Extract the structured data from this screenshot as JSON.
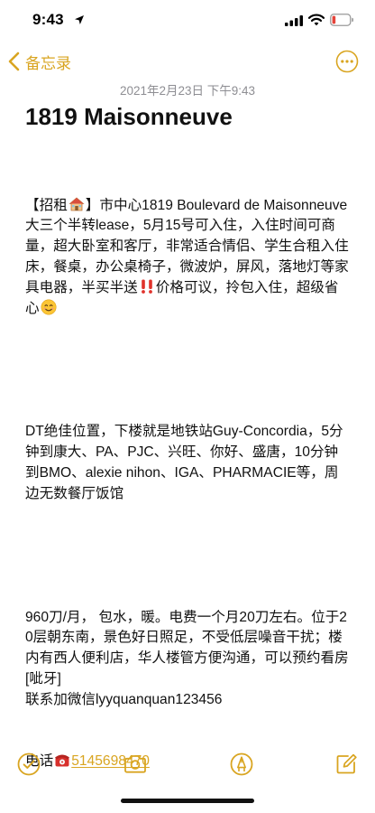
{
  "status_bar": {
    "time": "9:43"
  },
  "nav": {
    "back_label": "备忘录"
  },
  "note": {
    "date": "2021年2月23日 下午9:43",
    "title": "1819 Maisonneuve",
    "p1_a": "【招租",
    "p1_b": "】市中心1819 Boulevard de Maisonneuve大三个半转lease，5月15号可入住，入住时间可商量，超大卧室和客厅，非常适合情侣、学生合租入住\n床，餐桌，办公桌椅子，微波炉，屏风，落地灯等家具电器，半买半送",
    "p1_c": "价格可议，拎包入住，超级省心",
    "p2": "DT绝佳位置，下楼就是地铁站Guy-Concordia，5分钟到康大、PA、PJC、兴旺、你好、盛唐，10分钟到BMO、alexie nihon、IGA、PHARMACIE等，周边无数餐厅饭馆",
    "p3": "960刀/月， 包水，暖。电费一个月20刀左右。位于20层朝东南，景色好日照足，不受低层噪音干扰；楼内有西人便利店，华人楼管方便沟通，可以预约看房[呲牙]\n联系加微信lyyquanquan123456",
    "p4_label": "电话",
    "phone": "5145698470"
  },
  "icons": {
    "house": "house-emoji",
    "double_exclamation": "double-exclamation-emoji",
    "smile": "smiling-face-emoji",
    "telephone": "telephone-emoji"
  },
  "colors": {
    "accent": "#d9a521",
    "date_gray": "#8e8e93",
    "battery_red": "#e5443a"
  }
}
